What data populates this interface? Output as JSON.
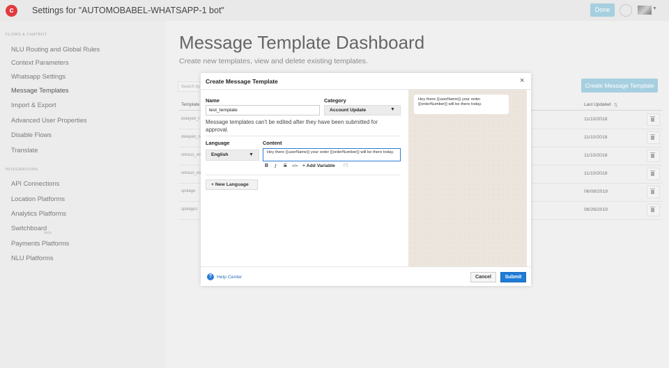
{
  "header": {
    "logo_letter": "c",
    "title": "Settings for \"AUTOMOBABEL-WHATSAPP-1 bot\"",
    "done_label": "Done"
  },
  "sidebar": {
    "section_flows": "FLOWS & CHATBOT",
    "flows_items": [
      {
        "label": "NLU Routing and Global Rules"
      },
      {
        "label": "Context Parameters"
      },
      {
        "label": "Whatsapp Settings"
      },
      {
        "label": "Message Templates"
      },
      {
        "label": "Import & Export"
      },
      {
        "label": "Advanced User Properties"
      },
      {
        "label": "Disable Flows"
      },
      {
        "label": "Translate"
      }
    ],
    "section_integrations": "INTEGRATIONS",
    "integration_items": [
      {
        "label": "API Connections"
      },
      {
        "label": "Location Platforms"
      },
      {
        "label": "Analytics Platforms"
      },
      {
        "label": "Switchboard"
      },
      {
        "label": "Payments Platforms"
      },
      {
        "label": "NLU Platforms"
      }
    ],
    "beta_badge": "beta"
  },
  "main": {
    "title": "Message Template Dashboard",
    "subtitle": "Create new templates, view and delete existing templates.",
    "create_button": "Create Message Template",
    "search_placeholder": "Search by",
    "table": {
      "col_template": "Template",
      "col_last_updated": "Last Updated",
      "sort_glyph": "⇅",
      "rows": [
        {
          "name": "delayed_f",
          "date": "11/10/2018"
        },
        {
          "name": "delayed_n",
          "date": "11/10/2018"
        },
        {
          "name": "retraso_en",
          "date": "11/10/2018"
        },
        {
          "name": "retraso_es",
          "date": "11/10/2018"
        },
        {
          "name": "spillage",
          "date": "06/08/2019"
        },
        {
          "name": "spillage2",
          "date": "06/26/2019"
        }
      ]
    }
  },
  "modal": {
    "title": "Create Message Template",
    "close_glyph": "×",
    "name_label": "Name",
    "name_value": "test_template",
    "category_label": "Category",
    "category_value": "Account Update",
    "note": "Message templates can't be edited after they have been submitted for approval.",
    "language_label": "Language",
    "language_value": "English",
    "content_label": "Content",
    "content_value": "Hey there {{userName}} your order {{orderNumber}} will be there today.",
    "format_bold": "B",
    "format_italic": "I",
    "format_strike": "S",
    "format_code": "</>",
    "add_variable": "+ Add Variable",
    "variable_help": "[?]",
    "new_language": "+ New Language",
    "preview_text": "Hey there {{userName}} your order {{orderNumber}} will be there today.",
    "help_glyph": "?",
    "help_center": "Help Center",
    "cancel": "Cancel",
    "submit": "Submit"
  },
  "colors": {
    "brand_red": "#e03a3e",
    "primary_blue": "#1f7bd6",
    "disabled_blue": "#a6cfe0",
    "preview_bg": "#ece5dd"
  }
}
